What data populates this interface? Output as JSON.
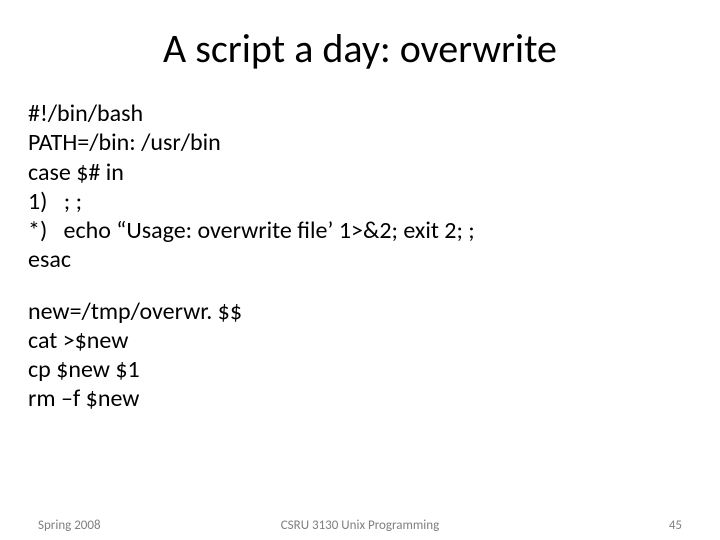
{
  "title": "A script a day: overwrite",
  "script": {
    "l1": "#!/bin/bash",
    "l2": "PATH=/bin: /usr/bin",
    "l3": "case $# in",
    "l4": "1)   ; ;",
    "l5": "*)   echo “Usage: overwrite file’ 1>&2; exit 2; ;",
    "l6": "esac"
  },
  "block2": {
    "l1": "new=/tmp/overwr. $$",
    "l2": "cat >$new",
    "l3": "cp $new $1",
    "l4": "rm –f $new"
  },
  "footer": {
    "left": "Spring 2008",
    "center": "CSRU 3130 Unix Programming",
    "right": "45"
  }
}
